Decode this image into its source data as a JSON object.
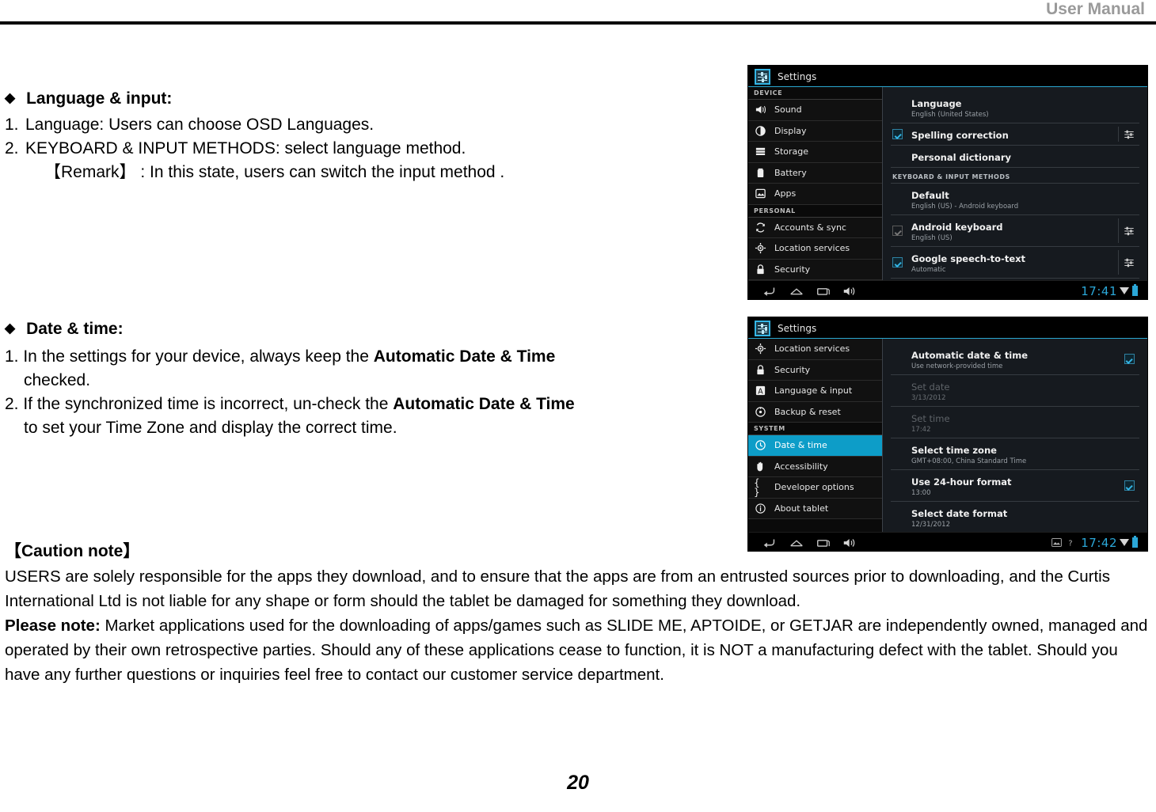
{
  "header": {
    "title": "User Manual"
  },
  "page_number": "20",
  "sections": [
    {
      "heading": "Language & input",
      "heading_suffix": ":",
      "lines": [
        {
          "num": "1.",
          "text": "Language: Users can choose OSD Languages."
        },
        {
          "num": "2.",
          "text": "KEYBOARD & INPUT METHODS: select language method."
        }
      ],
      "remark": "【Remark】 : In this state, users can switch the input method ."
    },
    {
      "heading": "Date & time",
      "heading_suffix": ":",
      "line1_pre": "1. In the settings for your device, always keep the ",
      "line1_bold": "Automatic Date & Time",
      "line1_cont": "checked.",
      "line2_pre": "2. If the synchronized time is incorrect, un-check the ",
      "line2_bold": "Automatic Date & Time",
      "line2_cont": "to set your Time Zone and display the correct time."
    }
  ],
  "caution": {
    "title": "【Caution note】",
    "paragraph1": "USERS are solely responsible for the apps they download, and to ensure that the apps are from an entrusted sources prior to downloading, and the Curtis International Ltd is not liable for any shape or form should the   tablet be damaged for something they download.",
    "note_label": "Please note:",
    "paragraph2": " Market applications used for the downloading of apps/games such as SLIDE ME, APTOIDE, or GETJAR are independently owned, managed and operated by their own retrospective parties. Should any of these applications cease to function, it is NOT a manufacturing defect with the tablet. Should you have any further questions or inquiries feel free to contact our customer service department."
  },
  "colors": {
    "accent_blue": "#33b5e5",
    "selected_row": "#0d9dc8",
    "clock_blue": "#2ba7d8"
  },
  "tablet1": {
    "title": "Settings",
    "sidebar": [
      {
        "type": "group",
        "label": "DEVICE"
      },
      {
        "type": "item",
        "label": "Sound",
        "icon": "sound-icon",
        "selected": false
      },
      {
        "type": "item",
        "label": "Display",
        "icon": "display-icon",
        "selected": false
      },
      {
        "type": "item",
        "label": "Storage",
        "icon": "storage-icon",
        "selected": false
      },
      {
        "type": "item",
        "label": "Battery",
        "icon": "battery-icon",
        "selected": false
      },
      {
        "type": "item",
        "label": "Apps",
        "icon": "apps-icon",
        "selected": false
      },
      {
        "type": "group",
        "label": "PERSONAL"
      },
      {
        "type": "item",
        "label": "Accounts & sync",
        "icon": "sync-icon",
        "selected": false
      },
      {
        "type": "item",
        "label": "Location services",
        "icon": "location-icon",
        "selected": false
      },
      {
        "type": "item",
        "label": "Security",
        "icon": "lock-icon",
        "selected": false
      }
    ],
    "detail": [
      {
        "kind": "row",
        "title": "Language",
        "sub": "English (United States)",
        "check": "none",
        "slider": false
      },
      {
        "kind": "row",
        "title": "Spelling correction",
        "sub": "",
        "check": "on",
        "slider": true
      },
      {
        "kind": "row",
        "title": "Personal dictionary",
        "sub": "",
        "check": "none",
        "slider": false
      },
      {
        "kind": "group",
        "label": "KEYBOARD & INPUT METHODS"
      },
      {
        "kind": "row",
        "title": "Default",
        "sub": "English (US) - Android keyboard",
        "check": "none",
        "slider": false
      },
      {
        "kind": "row",
        "title": "Android keyboard",
        "sub": "English (US)",
        "check": "dim-on",
        "slider": true
      },
      {
        "kind": "row",
        "title": "Google speech-to-text",
        "sub": "Automatic",
        "check": "on",
        "slider": true
      }
    ],
    "navbar": {
      "back_icon": "back-icon",
      "home_icon": "home-icon",
      "recents_icon": "recents-icon",
      "volume_icon": "volume-icon",
      "clock": "17:41",
      "wifi_icon": "wifi-icon",
      "battery_icon": "battery-status-icon",
      "status_icons": []
    }
  },
  "tablet2": {
    "title": "Settings",
    "sidebar": [
      {
        "type": "item",
        "label": "Location services",
        "icon": "location-icon",
        "selected": false
      },
      {
        "type": "item",
        "label": "Security",
        "icon": "lock-icon",
        "selected": false
      },
      {
        "type": "item",
        "label": "Language & input",
        "icon": "language-icon",
        "selected": false
      },
      {
        "type": "item",
        "label": "Backup & reset",
        "icon": "backup-icon",
        "selected": false
      },
      {
        "type": "group",
        "label": "SYSTEM"
      },
      {
        "type": "item",
        "label": "Date & time",
        "icon": "clock-icon",
        "selected": true
      },
      {
        "type": "item",
        "label": "Accessibility",
        "icon": "hand-icon",
        "selected": false
      },
      {
        "type": "item",
        "label": "Developer options",
        "icon": "braces-icon",
        "selected": false
      },
      {
        "type": "item",
        "label": "About tablet",
        "icon": "info-icon",
        "selected": false
      }
    ],
    "detail": [
      {
        "kind": "row",
        "title": "Automatic date & time",
        "sub": "Use network-provided time",
        "dim": false,
        "right_check": "on"
      },
      {
        "kind": "row",
        "title": "Set date",
        "sub": "3/13/2012",
        "dim": true,
        "right_check": "none"
      },
      {
        "kind": "row",
        "title": "Set time",
        "sub": "17:42",
        "dim": true,
        "right_check": "none"
      },
      {
        "kind": "row",
        "title": "Select time zone",
        "sub": "GMT+08:00, China Standard Time",
        "dim": false,
        "right_check": "none"
      },
      {
        "kind": "row",
        "title": "Use 24-hour format",
        "sub": "13:00",
        "dim": false,
        "right_check": "on"
      },
      {
        "kind": "row",
        "title": "Select date format",
        "sub": "12/31/2012",
        "dim": false,
        "right_check": "none"
      }
    ],
    "navbar": {
      "back_icon": "back-icon",
      "home_icon": "home-icon",
      "recents_icon": "recents-icon",
      "volume_icon": "volume-icon",
      "screenshot_icon": "screenshot-icon",
      "help_icon": "help-icon",
      "clock": "17:42",
      "wifi_icon": "wifi-icon",
      "battery_icon": "battery-status-icon"
    }
  }
}
